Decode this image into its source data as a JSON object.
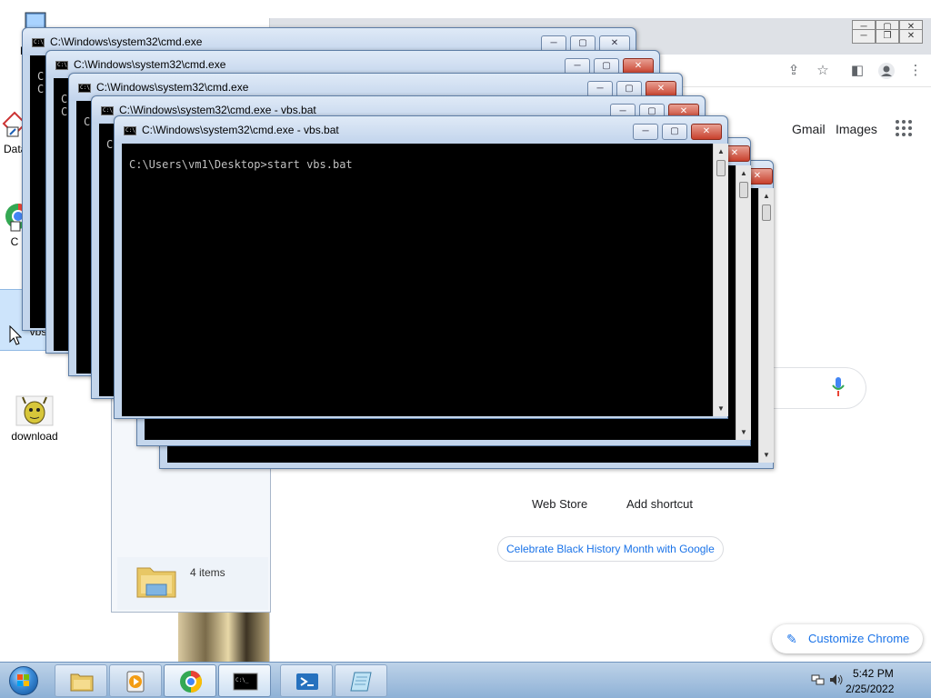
{
  "desktop": {
    "icons": [
      {
        "label": "My C",
        "name": "computer-icon"
      },
      {
        "label": "Data",
        "name": "shortcut-icon"
      },
      {
        "label": "C",
        "name": "chrome-shortcut-icon"
      },
      {
        "label": "vbs",
        "name": "bat-file-icon"
      },
      {
        "label": "download",
        "name": "download-image-icon"
      }
    ]
  },
  "chrome": {
    "gmail": "Gmail",
    "images": "Images",
    "shortcuts": [
      "Web Store",
      "Add shortcut"
    ],
    "celebrate": "Celebrate Black History Month with Google",
    "customize": "Customize Chrome"
  },
  "explorer": {
    "items_count": "4 items"
  },
  "cmd_windows": [
    {
      "title": "C:\\Windows\\system32\\cmd.exe",
      "text": "C:\nC:"
    },
    {
      "title": "C:\\Windows\\system32\\cmd.exe",
      "text": "C:\nC:"
    },
    {
      "title": "C:\\Windows\\system32\\cmd.exe",
      "text": "C:"
    },
    {
      "title": "C:\\Windows\\system32\\cmd.exe - vbs.bat",
      "text": "C:"
    },
    {
      "title": "C:\\Windows\\system32\\cmd.exe - vbs.bat",
      "text": "C:\\Users\\vm1\\Desktop>start vbs.bat"
    }
  ],
  "taskbar": {
    "items": [
      "windows-explorer-icon",
      "media-player-icon",
      "chrome-icon",
      "cmd-icon",
      "powershell-icon",
      "notepad-icon"
    ],
    "time": "5:42 PM",
    "date": "2/25/2022"
  }
}
